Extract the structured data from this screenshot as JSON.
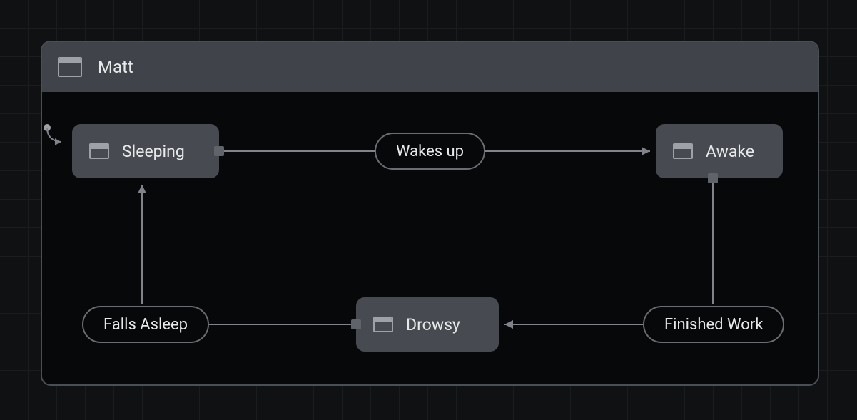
{
  "machine": {
    "title": "Matt",
    "states": {
      "sleeping": {
        "label": "Sleeping"
      },
      "awake": {
        "label": "Awake"
      },
      "drowsy": {
        "label": "Drowsy"
      }
    },
    "transitions": {
      "wakes_up": {
        "label": "Wakes up"
      },
      "finished_work": {
        "label": "Finished Work"
      },
      "falls_asleep": {
        "label": "Falls Asleep"
      }
    }
  },
  "icons": {
    "window": "window-icon"
  }
}
